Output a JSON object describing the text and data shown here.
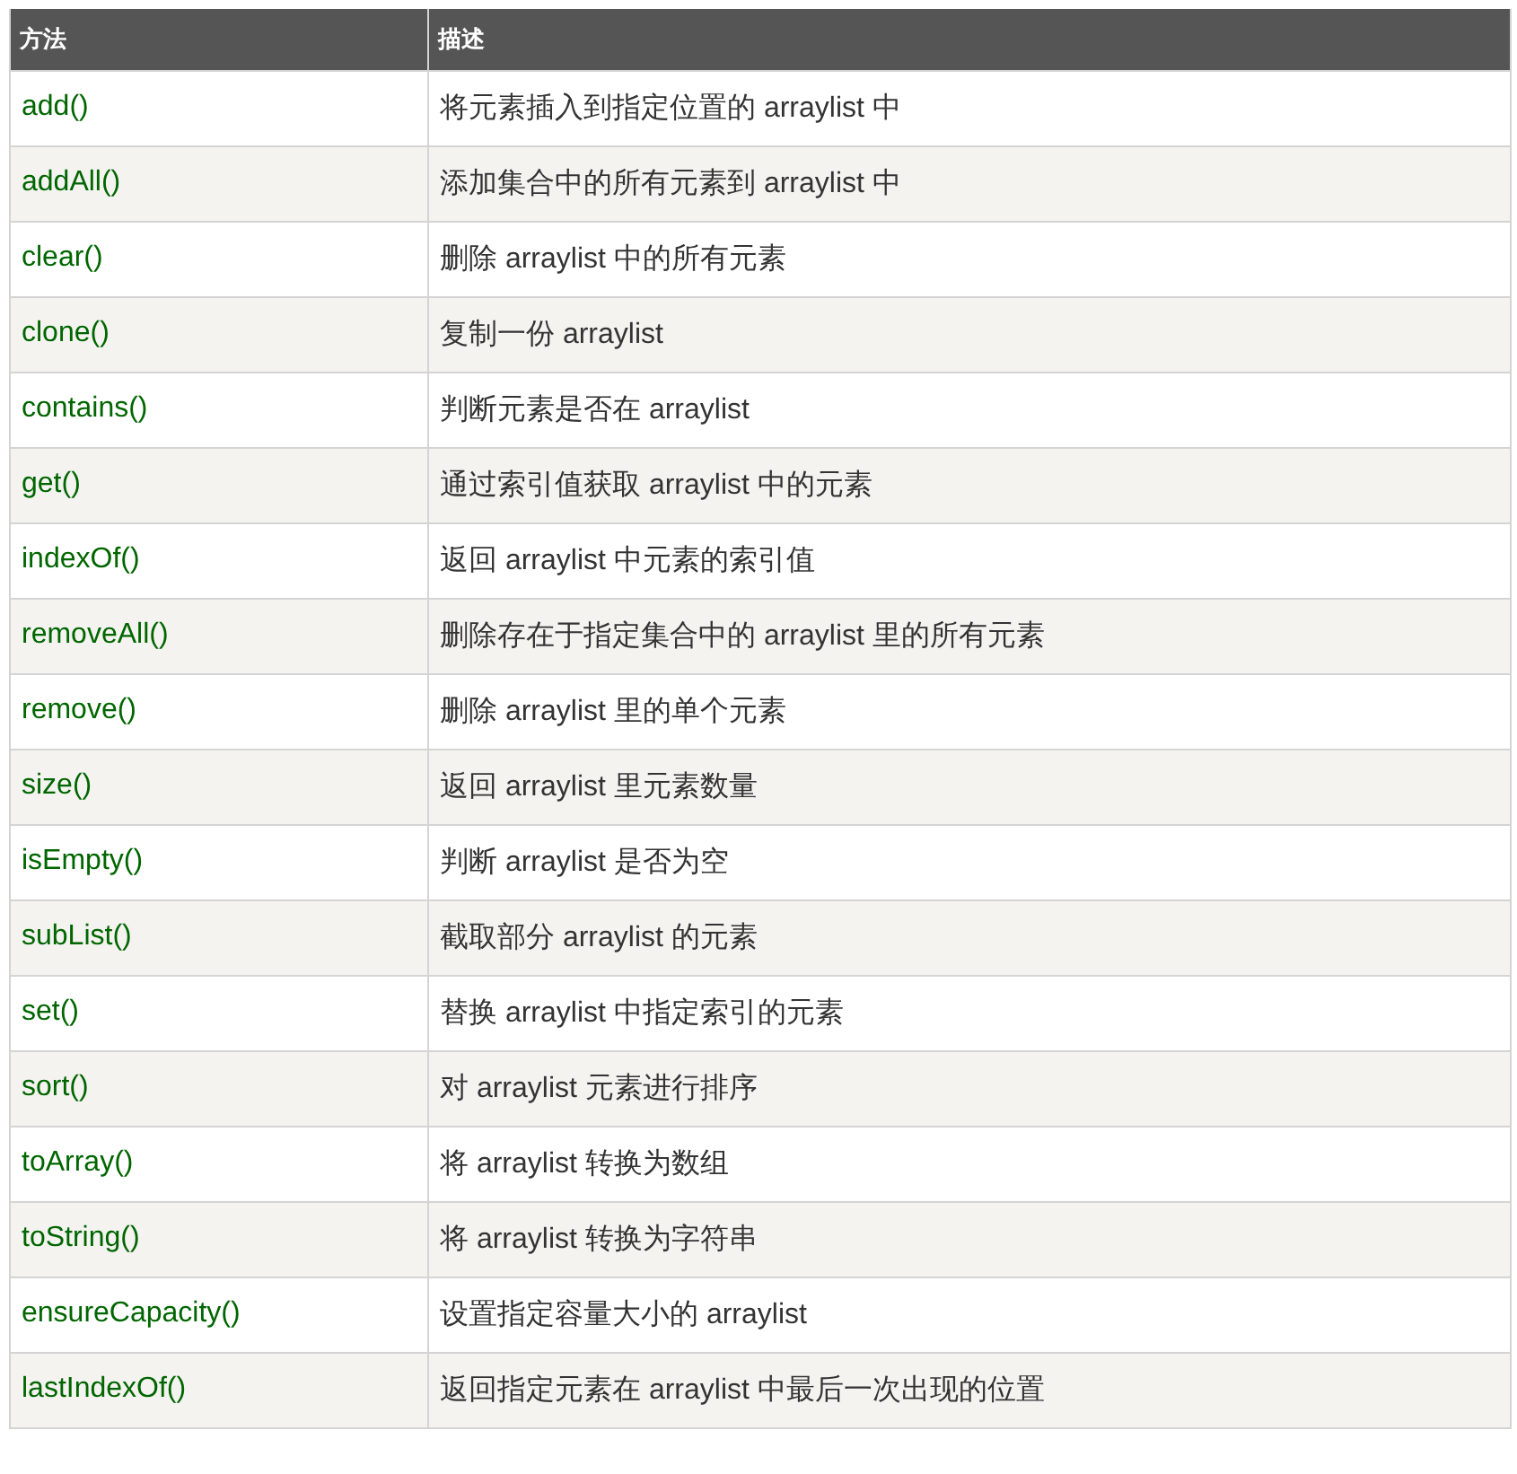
{
  "table": {
    "columns": [
      "方法",
      "描述"
    ],
    "rows": [
      {
        "method": "add()",
        "description": "将元素插入到指定位置的 arraylist 中"
      },
      {
        "method": "addAll()",
        "description": "添加集合中的所有元素到 arraylist 中"
      },
      {
        "method": "clear()",
        "description": "删除 arraylist 中的所有元素"
      },
      {
        "method": "clone()",
        "description": "复制一份 arraylist"
      },
      {
        "method": "contains()",
        "description": "判断元素是否在 arraylist"
      },
      {
        "method": "get()",
        "description": "通过索引值获取 arraylist 中的元素"
      },
      {
        "method": "indexOf()",
        "description": "返回 arraylist 中元素的索引值"
      },
      {
        "method": "removeAll()",
        "description": "删除存在于指定集合中的 arraylist 里的所有元素"
      },
      {
        "method": "remove()",
        "description": "删除 arraylist 里的单个元素"
      },
      {
        "method": "size()",
        "description": "返回 arraylist 里元素数量"
      },
      {
        "method": "isEmpty()",
        "description": "判断 arraylist 是否为空"
      },
      {
        "method": "subList()",
        "description": "截取部分 arraylist 的元素"
      },
      {
        "method": "set()",
        "description": "替换 arraylist 中指定索引的元素"
      },
      {
        "method": "sort()",
        "description": "对 arraylist 元素进行排序"
      },
      {
        "method": "toArray()",
        "description": "将 arraylist 转换为数组"
      },
      {
        "method": "toString()",
        "description": "将 arraylist 转换为字符串"
      },
      {
        "method": "ensureCapacity()",
        "description": "设置指定容量大小的 arraylist"
      },
      {
        "method": "lastIndexOf()",
        "description": "返回指定元素在 arraylist 中最后一次出现的位置"
      }
    ]
  }
}
